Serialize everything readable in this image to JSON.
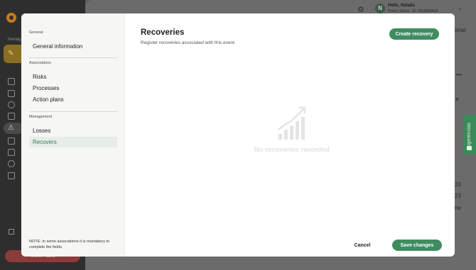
{
  "background": {
    "section_label": "Manag",
    "active_card_glyph": "✎",
    "active_nav_glyph": "⚠",
    "view_button_label": "View Plans",
    "user": {
      "avatar_initial": "N",
      "greeting": "Hello, Natalia",
      "subline": "Pirani | Demo - ID: 0000000419"
    },
    "right_fragments": [
      "torial",
      "•••",
      "✕",
      "23",
      "23",
      "ne"
    ]
  },
  "suggestion_tab": {
    "label": "Sugerencias"
  },
  "modal": {
    "nav": {
      "groups": [
        {
          "label": "General",
          "items": [
            "General information"
          ]
        },
        {
          "label": "Associations",
          "items": [
            "Risks",
            "Processes",
            "Action plans"
          ]
        },
        {
          "label": "Management",
          "items": [
            "Losses",
            "Recovers"
          ]
        }
      ],
      "active_item": "Recovers",
      "note": "NOTE: In some associations it is mandatory to complete the fields."
    },
    "title": "Recoveries",
    "subtitle": "Register recoveries associated with this event.",
    "create_button": "Create recovery",
    "empty_state": {
      "icon": "bar-chart-growth-icon",
      "text": "No recoveries recorded"
    },
    "cancel_button": "Cancel",
    "save_button": "Save changes"
  },
  "colors": {
    "accent": "#3f8c61",
    "active_nav_bg": "#e7ede8",
    "overlay": "#6b6b6b"
  }
}
